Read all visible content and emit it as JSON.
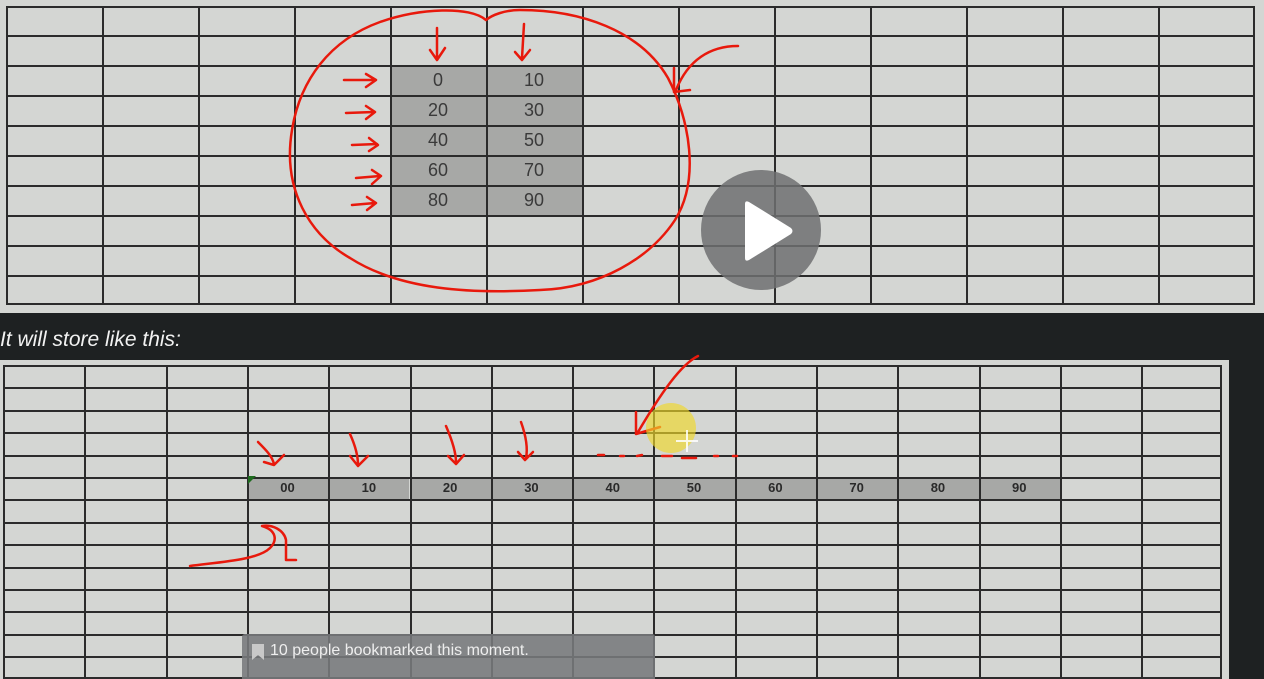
{
  "top_table": {
    "rows": [
      [
        "0",
        "10"
      ],
      [
        "20",
        "30"
      ],
      [
        "40",
        "50"
      ],
      [
        "60",
        "70"
      ],
      [
        "80",
        "90"
      ]
    ]
  },
  "caption": "It will store like this:",
  "bottom_table": {
    "values": [
      "00",
      "10",
      "20",
      "30",
      "40",
      "50",
      "60",
      "70",
      "80",
      "90"
    ]
  },
  "overlay": {
    "bookmark_text": "10 people bookmarked this moment."
  },
  "colors": {
    "annotation_red": "#e8190c",
    "highlight_yellow": "#f0d728",
    "cell_highlight": "#a7a8a6",
    "background": "#1e2122"
  },
  "icons": [
    "play-icon",
    "bookmark-icon"
  ]
}
